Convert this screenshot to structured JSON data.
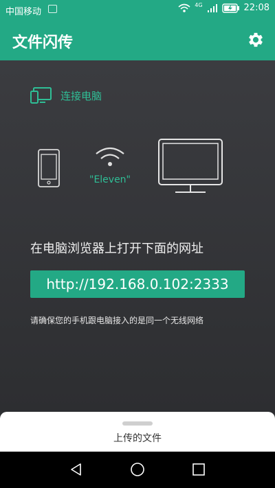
{
  "status_bar": {
    "carrier": "中国移动",
    "network": "4G",
    "time": "22:08"
  },
  "app_bar": {
    "title": "文件闪传",
    "settings_icon": "gear-icon"
  },
  "connect_section": {
    "label": "连接电脑",
    "icon": "monitor-phone-icon",
    "accent": "#2fbf96"
  },
  "devices": {
    "wifi_name": "\"Eleven\""
  },
  "instruction": "在电脑浏览器上打开下面的网址",
  "url": "http://192.168.0.102:2333",
  "note": "请确保您的手机跟电脑接入的是同一个无线网络",
  "bottom_sheet": {
    "label": "上传的文件"
  },
  "colors": {
    "primary": "#23a985",
    "accent": "#2fbf96",
    "background": "#2f3033"
  }
}
